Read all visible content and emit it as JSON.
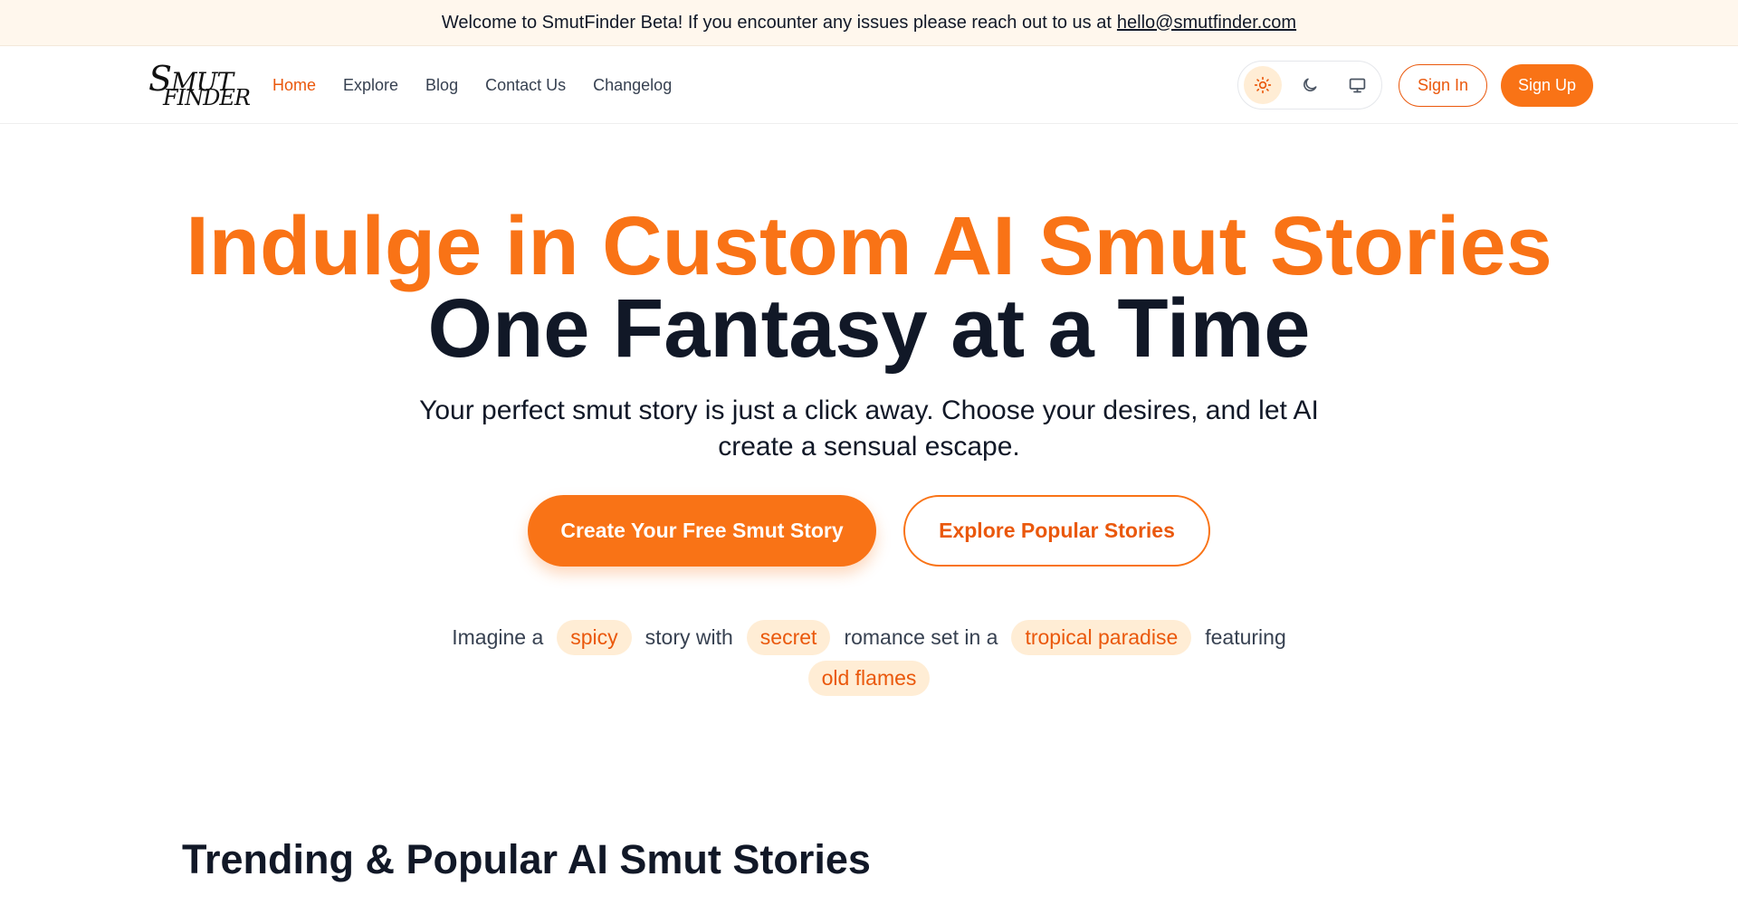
{
  "banner": {
    "text": "Welcome to SmutFinder Beta! If you encounter any issues please reach out to us at",
    "email": "hello@smutfinder.com"
  },
  "logo": {
    "line1_initial": "S",
    "line1_rest": "MUT",
    "line2": "FINDER"
  },
  "nav": {
    "links": [
      "Home",
      "Explore",
      "Blog",
      "Contact Us",
      "Changelog"
    ],
    "active": "Home"
  },
  "theme": {
    "options": [
      "sun-icon",
      "moon-icon",
      "monitor-icon"
    ],
    "selected": "sun-icon"
  },
  "auth": {
    "sign_in": "Sign In",
    "sign_up": "Sign Up"
  },
  "hero": {
    "line1": "Indulge in Custom AI Smut Stories",
    "line2": "One Fantasy at a Time",
    "subtitle": "Your perfect smut story is just a click away. Choose your desires, and let AI create a sensual escape.",
    "primary_cta": "Create Your Free Smut Story",
    "secondary_cta": "Explore Popular Stories"
  },
  "prompt": {
    "w1": "Imagine a",
    "c1": "spicy",
    "w2": "story with",
    "c2": "secret",
    "w3": "romance set in a",
    "c3": "tropical paradise",
    "w4": "featuring",
    "c4": "old flames"
  },
  "trending": {
    "title": "Trending & Popular AI Smut Stories"
  },
  "colors": {
    "accent": "#f97316",
    "accent_dark": "#ea580c",
    "chip_bg": "#ffedd5",
    "banner_bg": "#fff7ed",
    "text_dark": "#111827"
  }
}
